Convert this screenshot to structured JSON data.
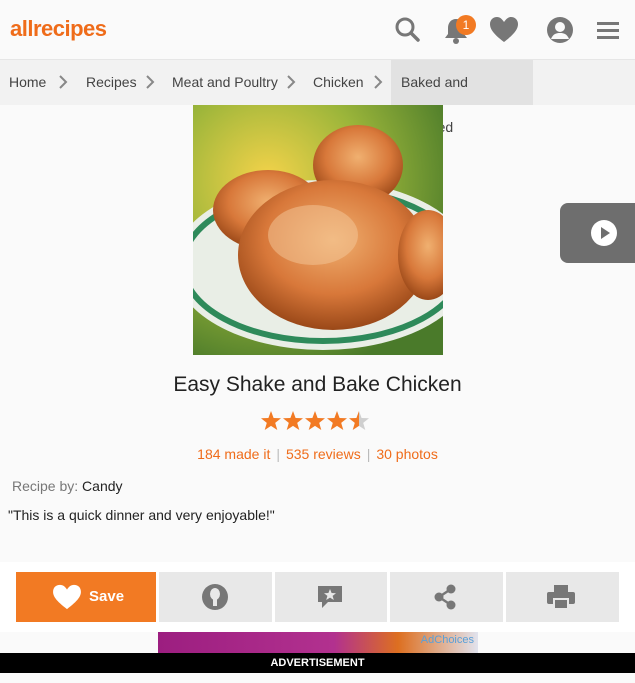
{
  "header": {
    "logo": "allrecipes",
    "notification_count": "1",
    "icons": [
      "search-icon",
      "bell-icon",
      "heart-icon",
      "user-icon",
      "menu-icon"
    ]
  },
  "breadcrumb": {
    "items": [
      "Home",
      "Recipes",
      "Meat and Poultry",
      "Chicken",
      "Baked and Roasted"
    ]
  },
  "recipe": {
    "title": "Easy Shake and Bake Chicken",
    "rating": 4.5,
    "made_it": "184 made it",
    "reviews": "535 reviews",
    "photos": "30 photos",
    "byline_label": "Recipe by:",
    "author": "Candy",
    "description": "\"This is a quick dinner and very enjoyable!\""
  },
  "actions": {
    "save_label": "Save"
  },
  "ad": {
    "adchoices": "AdChoices",
    "label": "ADVERTISEMENT"
  },
  "colors": {
    "accent": "#f27a23",
    "link": "#ef6c1a"
  }
}
